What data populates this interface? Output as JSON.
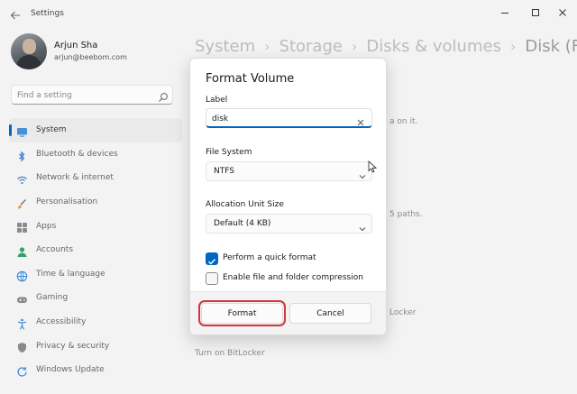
{
  "window": {
    "title": "Settings"
  },
  "profile": {
    "name": "Arjun Sha",
    "email": "arjun@beebom.com"
  },
  "search": {
    "placeholder": "Find a setting"
  },
  "sidebar": {
    "items": [
      {
        "label": "System",
        "icon": "system-icon",
        "active": true
      },
      {
        "label": "Bluetooth & devices",
        "icon": "bluetooth-icon"
      },
      {
        "label": "Network & internet",
        "icon": "network-icon"
      },
      {
        "label": "Personalisation",
        "icon": "brush-icon"
      },
      {
        "label": "Apps",
        "icon": "apps-icon"
      },
      {
        "label": "Accounts",
        "icon": "accounts-icon"
      },
      {
        "label": "Time & language",
        "icon": "globe-icon"
      },
      {
        "label": "Gaming",
        "icon": "gaming-icon"
      },
      {
        "label": "Accessibility",
        "icon": "accessibility-icon"
      },
      {
        "label": "Privacy & security",
        "icon": "shield-icon"
      },
      {
        "label": "Windows Update",
        "icon": "update-icon"
      }
    ]
  },
  "breadcrumb": [
    "System",
    "Storage",
    "Disks & volumes",
    "Disk (F:)"
  ],
  "background": {
    "text1": "a on it.",
    "text2": "5 paths.",
    "text3": "Locker",
    "text4": "Turn on BitLocker"
  },
  "dialog": {
    "title": "Format Volume",
    "label_label": "Label",
    "label_value": "disk",
    "filesystem_label": "File System",
    "filesystem_value": "NTFS",
    "allocation_label": "Allocation Unit Size",
    "allocation_value": "Default (4 KB)",
    "quick_format_label": "Perform a quick format",
    "quick_format_checked": true,
    "compression_label": "Enable file and folder compression",
    "compression_checked": false,
    "format_button": "Format",
    "cancel_button": "Cancel"
  },
  "colors": {
    "accent": "#0067c0",
    "highlight": "#d2353b"
  }
}
